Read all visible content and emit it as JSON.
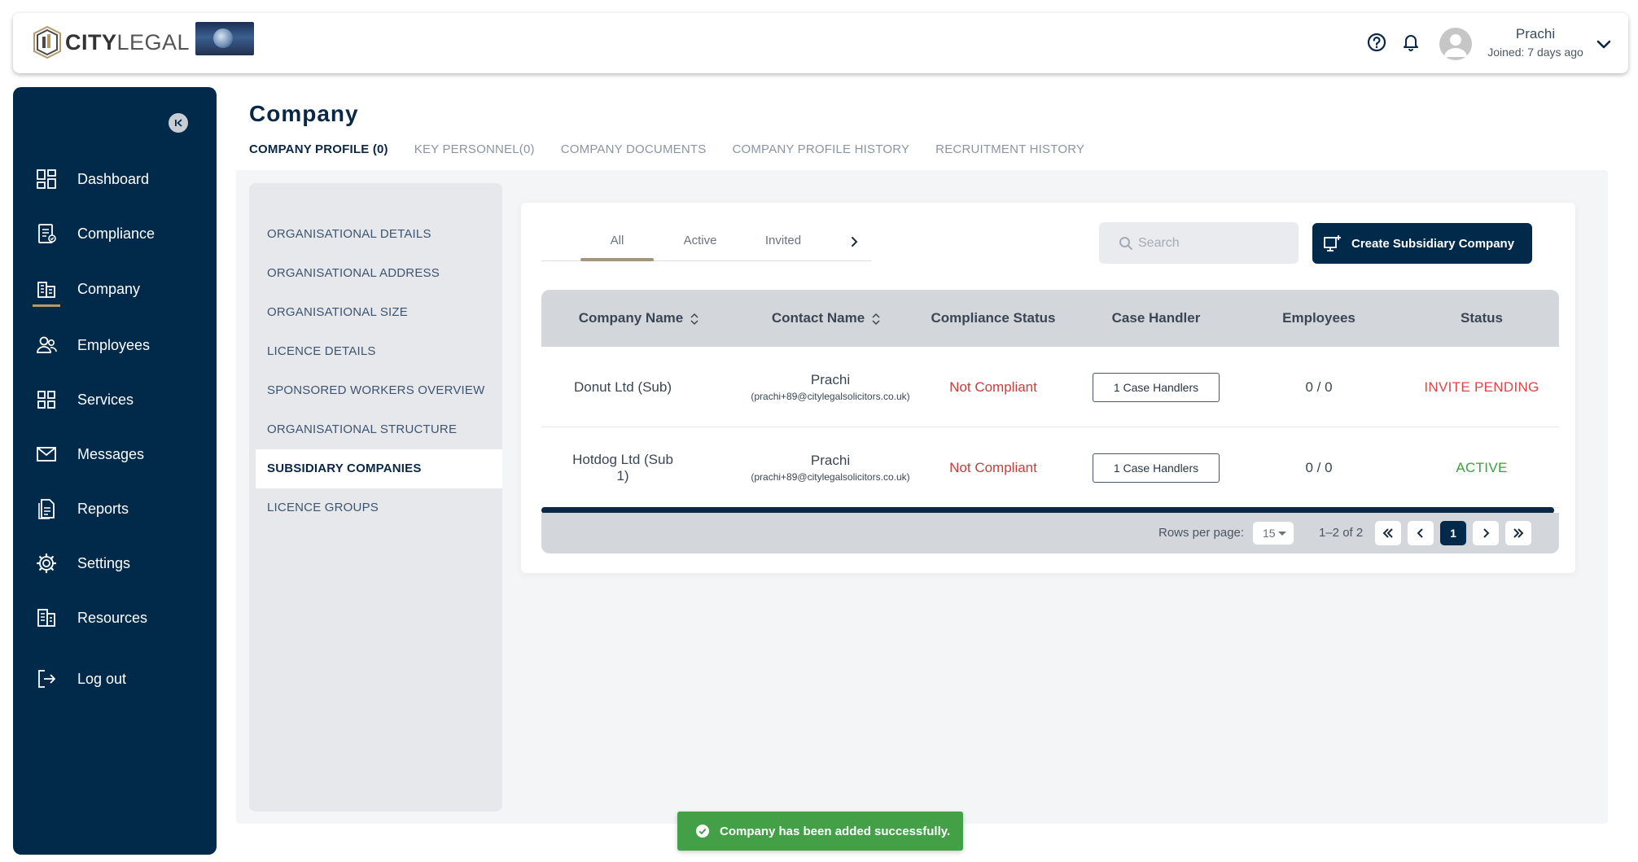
{
  "brand": {
    "name_bold": "CITY",
    "name_light": "LEGAL"
  },
  "user": {
    "name": "Prachi",
    "joined": "Joined: 7 days ago"
  },
  "sidebar": {
    "items": [
      {
        "label": "Dashboard",
        "icon": "dashboard-icon"
      },
      {
        "label": "Compliance",
        "icon": "compliance-icon"
      },
      {
        "label": "Company",
        "icon": "company-icon",
        "active": true
      },
      {
        "label": "Employees",
        "icon": "employees-icon"
      },
      {
        "label": "Services",
        "icon": "services-icon"
      },
      {
        "label": "Messages",
        "icon": "messages-icon"
      },
      {
        "label": "Reports",
        "icon": "reports-icon"
      },
      {
        "label": "Settings",
        "icon": "settings-icon"
      },
      {
        "label": "Resources",
        "icon": "resources-icon"
      },
      {
        "label": "Log out",
        "icon": "logout-icon"
      }
    ]
  },
  "page": {
    "title": "Company"
  },
  "tabs": [
    {
      "label": "COMPANY PROFILE (0)",
      "active": true
    },
    {
      "label": "KEY PERSONNEL(0)"
    },
    {
      "label": "COMPANY DOCUMENTS"
    },
    {
      "label": "COMPANY PROFILE HISTORY"
    },
    {
      "label": "RECRUITMENT HISTORY"
    }
  ],
  "left_menu": [
    {
      "label": "ORGANISATIONAL DETAILS"
    },
    {
      "label": "ORGANISATIONAL ADDRESS"
    },
    {
      "label": "ORGANISATIONAL SIZE"
    },
    {
      "label": "LICENCE DETAILS"
    },
    {
      "label": "SPONSORED WORKERS OVERVIEW"
    },
    {
      "label": "ORGANISATIONAL STRUCTURE"
    },
    {
      "label": "SUBSIDIARY COMPANIES",
      "active": true
    },
    {
      "label": "LICENCE GROUPS"
    }
  ],
  "filters": [
    {
      "label": "All",
      "active": true
    },
    {
      "label": "Active"
    },
    {
      "label": "Invited"
    }
  ],
  "search": {
    "placeholder": "Search"
  },
  "create_button": {
    "label": "Create Subsidiary Company"
  },
  "table": {
    "columns": [
      "Company Name",
      "Contact Name",
      "Compliance Status",
      "Case Handler",
      "Employees",
      "Status"
    ],
    "rows": [
      {
        "company": "Donut Ltd (Sub)",
        "contact": "Prachi",
        "email": "(prachi+89@citylegalsolicitors.co.uk)",
        "compliance": "Not Compliant",
        "handler": "1 Case Handlers",
        "employees": "0 / 0",
        "status": "INVITE PENDING"
      },
      {
        "company": "Hotdog Ltd (Sub 1)",
        "contact": "Prachi",
        "email": "(prachi+89@citylegalsolicitors.co.uk)",
        "compliance": "Not Compliant",
        "handler": "1 Case Handlers",
        "employees": "0 / 0",
        "status": "ACTIVE"
      }
    ]
  },
  "pagination": {
    "rows_label": "Rows per page:",
    "rows_value": "15",
    "range": "1–2 of 2",
    "current_page": "1"
  },
  "toast": {
    "message": "Company has been added successfully."
  },
  "colors": {
    "navy": "#012a4a",
    "gold": "#b49a6a",
    "danger": "#d03a3a",
    "success": "#38a33a",
    "toast": "#43a047"
  }
}
